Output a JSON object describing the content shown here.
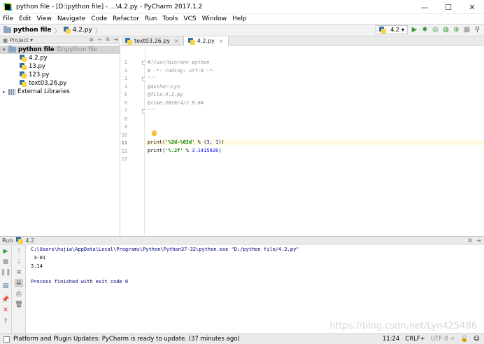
{
  "window": {
    "title": "python file - [D:\\python file] - ...\\4.2.py - PyCharm 2017.1.2",
    "minimize": "—",
    "maximize": "☐",
    "close": "✕"
  },
  "menu": [
    "File",
    "Edit",
    "View",
    "Navigate",
    "Code",
    "Refactor",
    "Run",
    "Tools",
    "VCS",
    "Window",
    "Help"
  ],
  "nav": {
    "project": "python file",
    "file": "4.2.py",
    "run_config": "4.2"
  },
  "project_panel": {
    "title": "Project",
    "root": "python file",
    "root_path": "D:\\python file",
    "files": [
      "4.2.py",
      "13.py",
      "123.py",
      "text03.26.py"
    ],
    "external": "External Libraries"
  },
  "tabs": [
    {
      "label": "text03.26.py",
      "active": false
    },
    {
      "label": "4.2.py",
      "active": true
    }
  ],
  "editor": {
    "line_numbers": [
      "1",
      "2",
      "3",
      "4",
      "5",
      "6",
      "7",
      "8",
      "9",
      "10",
      "11",
      "12",
      "13"
    ],
    "lines": [
      "#!/usr/bin/env python",
      "# -*- coding: utf-8 -*-",
      "'''",
      "@author:Lyn",
      "@file:4.2.py",
      "@time:2019/4/2 9:04",
      "'''",
      "",
      "",
      "",
      "print('%2d-%02d' % (3, 1))",
      "print('%.2f' % 3.1415926)",
      ""
    ],
    "current_line": 11
  },
  "run_panel": {
    "title": "Run",
    "config": "4.2",
    "output": [
      "C:\\Users\\hujia\\AppData\\Local\\Programs\\Python\\Python37-32\\python.exe \"D:/python file/4.2.py\"",
      " 3-01",
      "3.14",
      "",
      "Process finished with exit code 0"
    ],
    "watermark": "https://blog.csdn.net/Lyn425486"
  },
  "status": {
    "message": "Platform and Plugin Updates: PyCharm is ready to update. (37 minutes ago)",
    "position": "11:24",
    "line_sep": "CRLF÷",
    "encoding": "UTF-8 ÷"
  },
  "colors": {
    "string": "#008000",
    "comment": "#8c8c8c",
    "number": "#0000ff",
    "console_cmd": "#00007f",
    "run_green": "#3a9b3a"
  }
}
